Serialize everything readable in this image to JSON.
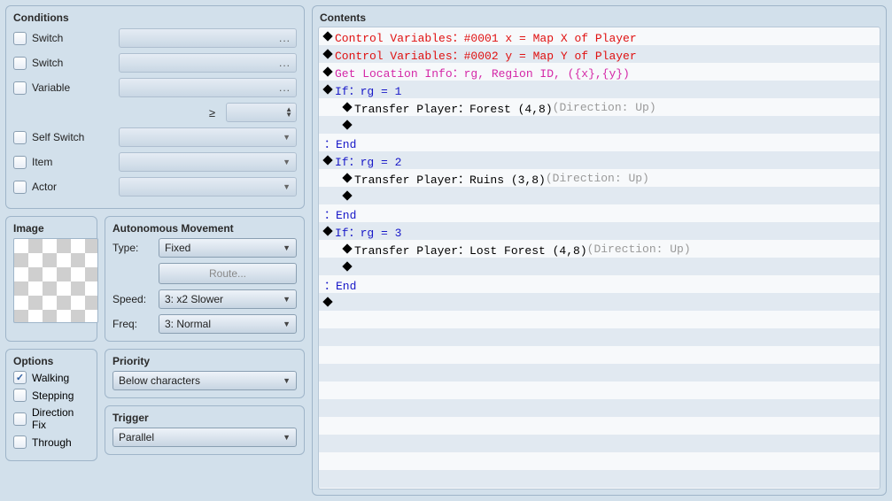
{
  "conditions": {
    "title": "Conditions",
    "items": [
      {
        "label": "Switch",
        "type": "dots"
      },
      {
        "label": "Switch",
        "type": "dots"
      },
      {
        "label": "Variable",
        "type": "dots"
      },
      {
        "label": "",
        "type": "spinner",
        "prefix": "≥"
      },
      {
        "label": "Self Switch",
        "type": "drop"
      },
      {
        "label": "Item",
        "type": "drop"
      },
      {
        "label": "Actor",
        "type": "drop"
      }
    ]
  },
  "image": {
    "title": "Image"
  },
  "movement": {
    "title": "Autonomous Movement",
    "type_label": "Type:",
    "type_value": "Fixed",
    "route_label": "Route...",
    "speed_label": "Speed:",
    "speed_value": "3: x2 Slower",
    "freq_label": "Freq:",
    "freq_value": "3: Normal"
  },
  "options": {
    "title": "Options",
    "items": [
      {
        "label": "Walking",
        "checked": true
      },
      {
        "label": "Stepping",
        "checked": false
      },
      {
        "label": "Direction Fix",
        "checked": false
      },
      {
        "label": "Through",
        "checked": false
      }
    ]
  },
  "priority": {
    "title": "Priority",
    "value": "Below characters"
  },
  "trigger": {
    "title": "Trigger",
    "value": "Parallel"
  },
  "contents": {
    "title": "Contents",
    "lines": [
      {
        "indent": 0,
        "d": true,
        "color": "red",
        "text": "Control Variables：#0001 x = Map X of Player"
      },
      {
        "indent": 0,
        "d": true,
        "color": "red",
        "text": "Control Variables：#0002 y = Map Y of Player"
      },
      {
        "indent": 0,
        "d": true,
        "color": "magenta",
        "text": "Get Location Info：rg, Region ID, ({x},{y})"
      },
      {
        "indent": 0,
        "d": true,
        "color": "blue",
        "text": "If：rg = 1"
      },
      {
        "indent": 1,
        "d": true,
        "color": "black",
        "text": "Transfer Player：Forest (4,8)",
        "suffix": " (Direction: Up)"
      },
      {
        "indent": 1,
        "d": true,
        "color": "blue",
        "text": ""
      },
      {
        "indent": 0,
        "d": false,
        "color": "blue",
        "text": "：End"
      },
      {
        "indent": 0,
        "d": true,
        "color": "blue",
        "text": "If：rg = 2"
      },
      {
        "indent": 1,
        "d": true,
        "color": "black",
        "text": "Transfer Player：Ruins (3,8)",
        "suffix": " (Direction: Up)"
      },
      {
        "indent": 1,
        "d": true,
        "color": "blue",
        "text": ""
      },
      {
        "indent": 0,
        "d": false,
        "color": "blue",
        "text": "：End"
      },
      {
        "indent": 0,
        "d": true,
        "color": "blue",
        "text": "If：rg = 3"
      },
      {
        "indent": 1,
        "d": true,
        "color": "black",
        "text": "Transfer Player：Lost Forest (4,8)",
        "suffix": " (Direction: Up)"
      },
      {
        "indent": 1,
        "d": true,
        "color": "blue",
        "text": ""
      },
      {
        "indent": 0,
        "d": false,
        "color": "blue",
        "text": "：End"
      },
      {
        "indent": 0,
        "d": true,
        "color": "blue",
        "text": ""
      }
    ],
    "blank_rows": 10
  }
}
